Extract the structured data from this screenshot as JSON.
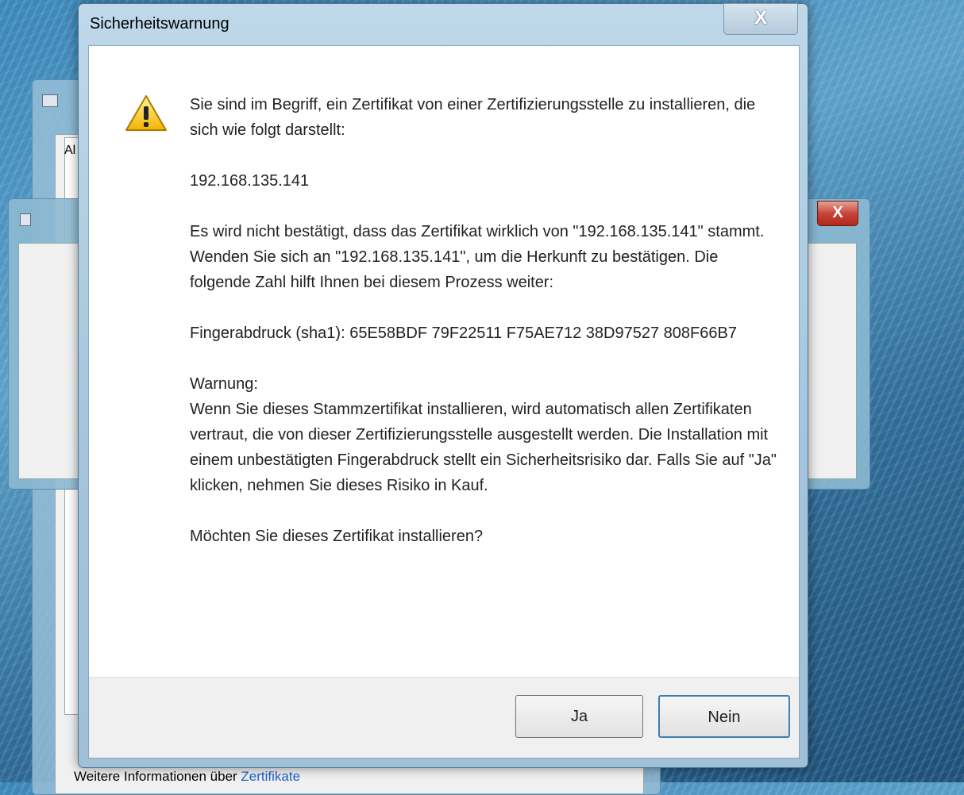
{
  "background_window": {
    "tab_label": "Al",
    "info_text": "Weitere Informationen über ",
    "info_link": "Zertifikate"
  },
  "background_window2": {
    "close_label": "X"
  },
  "dialog": {
    "title": "Sicherheitswarnung",
    "close_label": "X",
    "icon": "warning-triangle-icon",
    "paragraphs": [
      "Sie sind im Begriff, ein Zertifikat von einer Zertifizierungsstelle zu installieren, die sich wie folgt darstellt:",
      "192.168.135.141",
      "Es wird nicht bestätigt, dass das Zertifikat wirklich von \"192.168.135.141\" stammt. Wenden Sie sich an \"192.168.135.141\", um die Herkunft zu bestätigen. Die folgende Zahl hilft Ihnen bei diesem Prozess weiter:",
      "Fingerabdruck (sha1): 65E58BDF 79F22511 F75AE712 38D97527 808F66B7",
      "Warnung:",
      "Wenn Sie dieses Stammzertifikat installieren, wird automatisch allen Zertifikaten vertraut, die von dieser Zertifizierungsstelle ausgestellt werden. Die Installation mit einem unbestätigten Fingerabdruck stellt ein Sicherheitsrisiko dar. Falls Sie auf \"Ja\" klicken, nehmen Sie dieses Risiko in Kauf.",
      "Möchten Sie dieses Zertifikat installieren?"
    ],
    "buttons": {
      "yes": "Ja",
      "no": "Nein"
    }
  },
  "colors": {
    "warning_yellow": "#f5c400",
    "focus_border": "#3c7fb1"
  }
}
